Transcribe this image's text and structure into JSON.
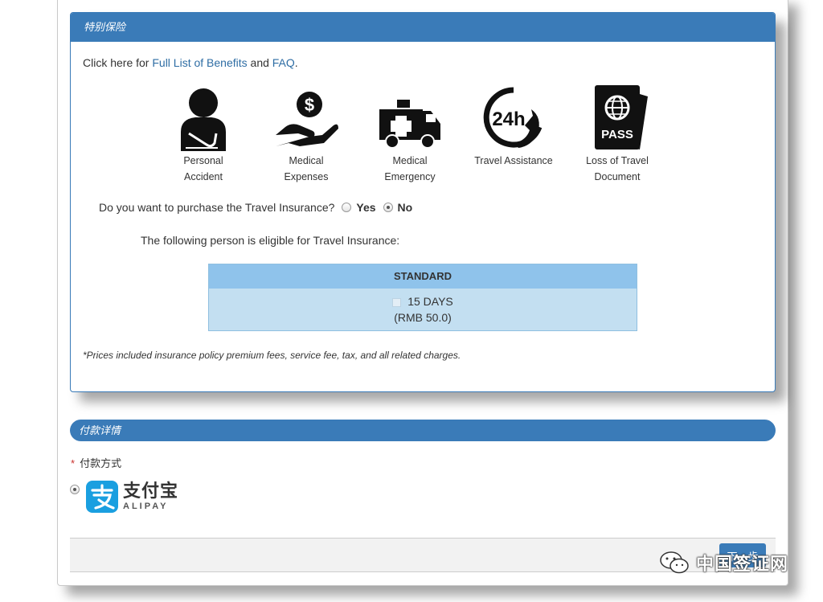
{
  "insurance": {
    "header": "特别保险",
    "intro_prefix": "Click here for ",
    "benefits_link": "Full List of Benefits",
    "intro_and": " and ",
    "faq_link": "FAQ",
    "intro_suffix": ".",
    "benefits": [
      {
        "icon": "person-sling-icon",
        "label": "Personal",
        "label2": "Accident"
      },
      {
        "icon": "hand-money-icon",
        "label": "Medical",
        "label2": "Expenses"
      },
      {
        "icon": "ambulance-icon",
        "label": "Medical",
        "label2": "Emergency"
      },
      {
        "icon": "24h-phone-icon",
        "label": "Travel Assistance",
        "label2": ""
      },
      {
        "icon": "passport-icon",
        "label": "Loss of Travel",
        "label2": "Document"
      }
    ],
    "question": "Do you want to purchase the Travel Insurance?",
    "yes_label": "Yes",
    "no_label": "No",
    "selected": "No",
    "eligible_text": "The following person is eligible for Travel Insurance:",
    "plan": {
      "header": "STANDARD",
      "option": "15 DAYS",
      "price": "(RMB 50.0)"
    },
    "footnote": "*Prices included insurance policy premium fees, service fee, tax, and all related charges."
  },
  "payment": {
    "header": "付款详情",
    "required_mark": "*",
    "method_label": "付款方式",
    "alipay_cn": "支付宝",
    "alipay_en": "ALIPAY"
  },
  "actions": {
    "next_label": "下一步"
  },
  "watermark": {
    "text": "中国签证网"
  },
  "colors": {
    "primary": "#3a7bb8",
    "plan_header": "#8fc3eb",
    "plan_body": "#c3dff1",
    "alipay_blue": "#1a9fe0",
    "link": "#2e6da4"
  }
}
